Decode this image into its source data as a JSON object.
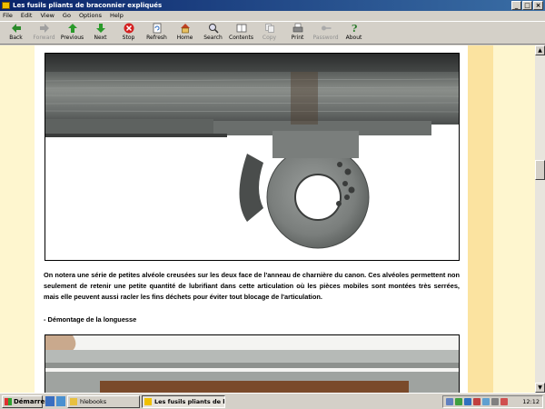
{
  "window": {
    "title": "Les fusils pliants de braconnier expliqués"
  },
  "menu": [
    "File",
    "Edit",
    "View",
    "Go",
    "Options",
    "Help"
  ],
  "toolbar": [
    {
      "label": "Back",
      "icon": "back-arrow-icon",
      "enabled": true
    },
    {
      "label": "Forward",
      "icon": "forward-arrow-icon",
      "enabled": false
    },
    {
      "label": "Previous",
      "icon": "up-arrow-icon",
      "enabled": true
    },
    {
      "label": "Next",
      "icon": "down-arrow-icon",
      "enabled": true
    },
    {
      "label": "Stop",
      "icon": "stop-icon",
      "enabled": true
    },
    {
      "label": "Refresh",
      "icon": "refresh-icon",
      "enabled": true
    },
    {
      "label": "Home",
      "icon": "home-icon",
      "enabled": true
    },
    {
      "label": "Search",
      "icon": "search-icon",
      "enabled": true
    },
    {
      "label": "Contents",
      "icon": "contents-icon",
      "enabled": true
    },
    {
      "label": "Copy",
      "icon": "copy-icon",
      "enabled": false
    },
    {
      "label": "Print",
      "icon": "print-icon",
      "enabled": true
    },
    {
      "label": "Password",
      "icon": "key-icon",
      "enabled": false
    },
    {
      "label": "About",
      "icon": "about-icon",
      "enabled": true
    }
  ],
  "content": {
    "paragraph": "On notera une série de petites alvéole creusées sur les deux face de l'anneau de charnière du canon. Ces alvéoles permettent non seulement de retenir une petite quantité de lubrifiant dans cette articulation où les pièces mobiles sont montées très serrées, mais elle peuvent aussi racler les fins déchets pour éviter tout blocage de l'articulation.",
    "subheading": "- Démontage de la longuesse"
  },
  "taskbar": {
    "start_label": "Démarrer",
    "tasks": [
      {
        "label": "hlebooks",
        "active": false
      },
      {
        "label": "Les fusils pliants de b...",
        "active": true
      }
    ],
    "clock": "12:12"
  },
  "colors": {
    "page_background": "#fef9d6",
    "right_stripe": "#fbe3a0",
    "title_bar": "#0a246a"
  }
}
